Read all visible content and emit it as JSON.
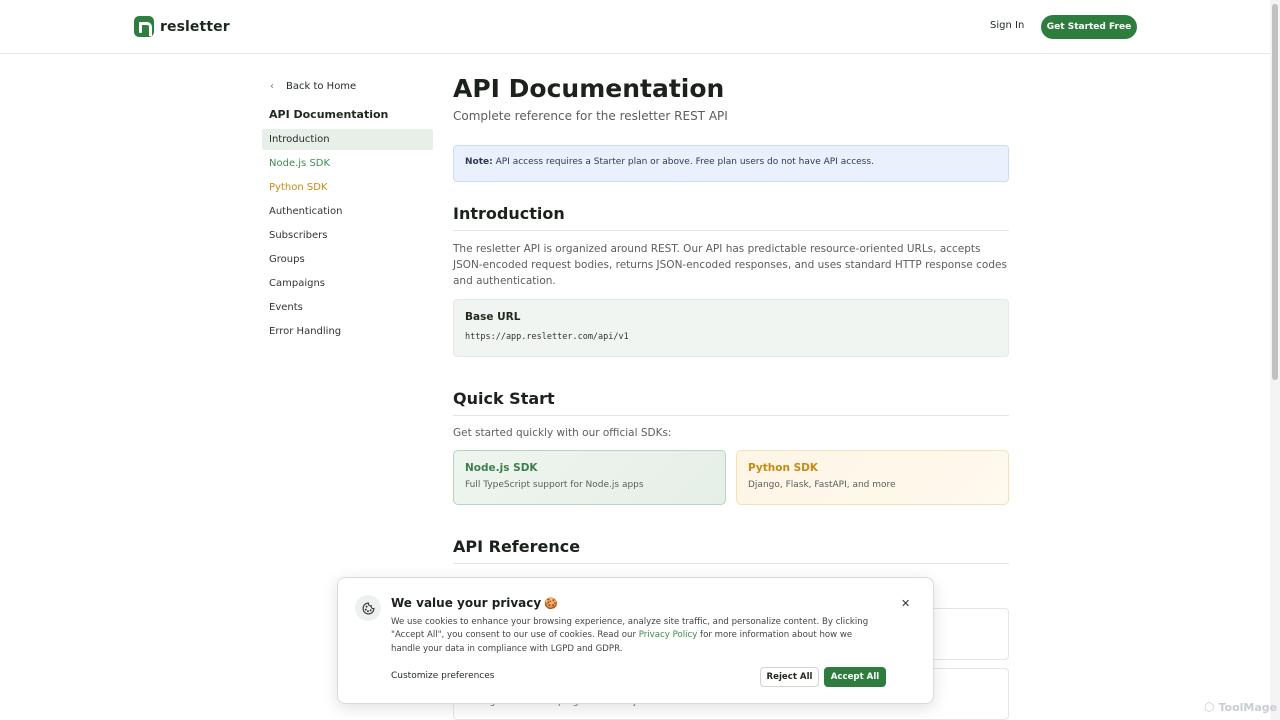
{
  "header": {
    "brand": "resletter",
    "sign_in": "Sign In",
    "cta": "Get Started Free"
  },
  "sidebar": {
    "back": "Back to Home",
    "title": "API Documentation",
    "items": [
      {
        "label": "Introduction"
      },
      {
        "label": "Node.js SDK"
      },
      {
        "label": "Python SDK"
      },
      {
        "label": "Authentication"
      },
      {
        "label": "Subscribers"
      },
      {
        "label": "Groups"
      },
      {
        "label": "Campaigns"
      },
      {
        "label": "Events"
      },
      {
        "label": "Error Handling"
      }
    ]
  },
  "main": {
    "title": "API Documentation",
    "subtitle": "Complete reference for the resletter REST API",
    "note_label": "Note:",
    "note_text": " API access requires a Starter plan or above. Free plan users do not have API access.",
    "intro_heading": "Introduction",
    "intro_paragraph": "The resletter API is organized around REST. Our API has predictable resource-oriented URLs, accepts JSON-encoded request bodies, returns JSON-encoded responses, and uses standard HTTP response codes and authentication.",
    "base_url_label": "Base URL",
    "base_url": "https://app.resletter.com/api/v1",
    "quickstart_heading": "Quick Start",
    "quickstart_lead": "Get started quickly with our official SDKs:",
    "sdks": [
      {
        "title": "Node.js SDK",
        "desc": "Full TypeScript support for Node.js apps"
      },
      {
        "title": "Python SDK",
        "desc": "Django, Flask, FastAPI, and more"
      }
    ],
    "api_ref_heading": "API Reference",
    "ref_partial_desc": "Manage subscribers programmatically"
  },
  "cookie": {
    "title": "We value your privacy",
    "emoji": "🍪",
    "text_before": "We use cookies to enhance your browsing experience, analyze site traffic, and personalize content. By clicking \"Accept All\", you consent to our use of cookies. Read our ",
    "link": "Privacy Policy",
    "text_after": " for more information about how we handle your data in compliance with LGPD and GDPR.",
    "customize": "Customize preferences",
    "reject": "Reject All",
    "accept": "Accept All"
  },
  "watermark": "ToolMage",
  "colors": {
    "brand_green": "#2e7d3e",
    "node_green": "#3f8a4e",
    "python_orange": "#c98a12",
    "note_bg": "#eaf1fd"
  },
  "icons": {
    "back": "chevron-left-icon",
    "cookie": "cookie-icon",
    "close": "close-icon"
  }
}
